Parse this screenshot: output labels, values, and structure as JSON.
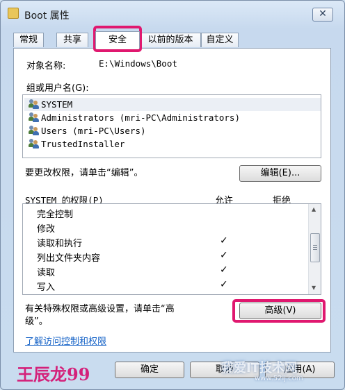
{
  "window": {
    "title": "Boot 属性",
    "close_glyph": "✕"
  },
  "tabs": [
    {
      "label": "常规"
    },
    {
      "label": "共享"
    },
    {
      "label": "安全",
      "active": true
    },
    {
      "label": "以前的版本"
    },
    {
      "label": "自定义"
    }
  ],
  "security": {
    "object_label": "对象名称:",
    "object_value": "E:\\Windows\\Boot",
    "groups_label": "组或用户名(G):",
    "users": [
      {
        "name": "SYSTEM",
        "selected": true,
        "icon": "users-icon"
      },
      {
        "name": "Administrators (mri-PC\\Administrators)",
        "icon": "users-icon"
      },
      {
        "name": "Users (mri-PC\\Users)",
        "icon": "users-icon"
      },
      {
        "name": "TrustedInstaller",
        "icon": "users-icon"
      }
    ],
    "edit_hint": "要更改权限，请单击“编辑”。",
    "edit_button": "编辑(E)...",
    "perm_header": "SYSTEM 的权限(P)",
    "allow_header": "允许",
    "deny_header": "拒绝",
    "permissions": [
      {
        "name": "完全控制",
        "allow": ""
      },
      {
        "name": "修改",
        "allow": ""
      },
      {
        "name": "读取和执行",
        "allow": "✓"
      },
      {
        "name": "列出文件夹内容",
        "allow": "✓"
      },
      {
        "name": "读取",
        "allow": "✓"
      },
      {
        "name": "写入",
        "allow": "✓"
      }
    ],
    "advanced_hint_line1": "有关特殊权限或高级设置，请单击“高",
    "advanced_hint_line2": "级”。",
    "advanced_button": "高级(V)",
    "learn_link": "了解访问控制和权限"
  },
  "footer": {
    "ok_button": "确定",
    "cancel_button": "取消",
    "apply_button": "应用(A)"
  },
  "overlay": {
    "signature": "王辰龙99",
    "watermark": "我爱IT技术网",
    "watermark_url": "www.52ij.com",
    "highlight_color": "#e0186f"
  }
}
